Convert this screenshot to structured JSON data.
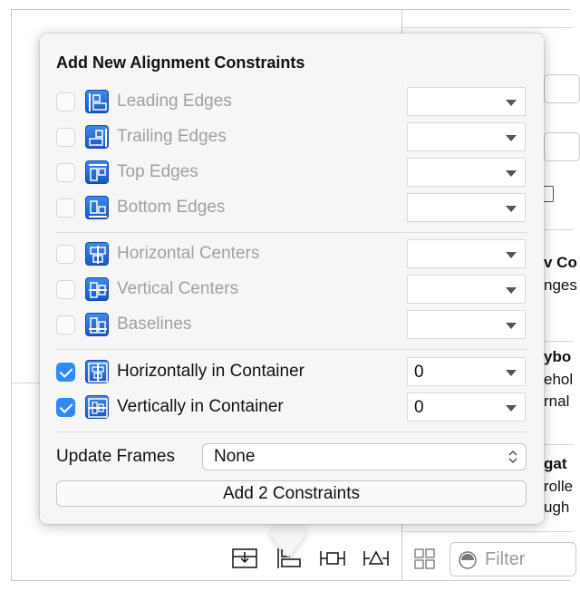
{
  "popover": {
    "title": "Add New Alignment Constraints",
    "groups": [
      [
        {
          "label": "Leading Edges",
          "checked": false,
          "icon": "leading-edges-icon",
          "value": ""
        },
        {
          "label": "Trailing Edges",
          "checked": false,
          "icon": "trailing-edges-icon",
          "value": ""
        },
        {
          "label": "Top Edges",
          "checked": false,
          "icon": "top-edges-icon",
          "value": ""
        },
        {
          "label": "Bottom Edges",
          "checked": false,
          "icon": "bottom-edges-icon",
          "value": ""
        }
      ],
      [
        {
          "label": "Horizontal Centers",
          "checked": false,
          "icon": "horizontal-centers-icon",
          "value": ""
        },
        {
          "label": "Vertical Centers",
          "checked": false,
          "icon": "vertical-centers-icon",
          "value": ""
        },
        {
          "label": "Baselines",
          "checked": false,
          "icon": "baselines-icon",
          "value": ""
        }
      ],
      [
        {
          "label": "Horizontally in Container",
          "checked": true,
          "icon": "horizontal-center-container-icon",
          "value": "0"
        },
        {
          "label": "Vertically in Container",
          "checked": true,
          "icon": "vertical-center-container-icon",
          "value": "0"
        }
      ]
    ],
    "update_frames_label": "Update Frames",
    "update_frames_value": "None",
    "add_button": "Add 2 Constraints"
  },
  "background": {
    "snippets": [
      "v Co",
      "nges",
      "ybo",
      "ehol",
      "rnal",
      "gat",
      "rolle",
      "ugh"
    ]
  },
  "toolbar": {
    "icons": [
      "embed-in-stack-icon",
      "align-icon",
      "pin-icon",
      "resolve-issues-icon"
    ],
    "filter_placeholder": "Filter"
  },
  "colors": {
    "accent": "#2f8af5",
    "icon_blue": "#1f63d4"
  }
}
